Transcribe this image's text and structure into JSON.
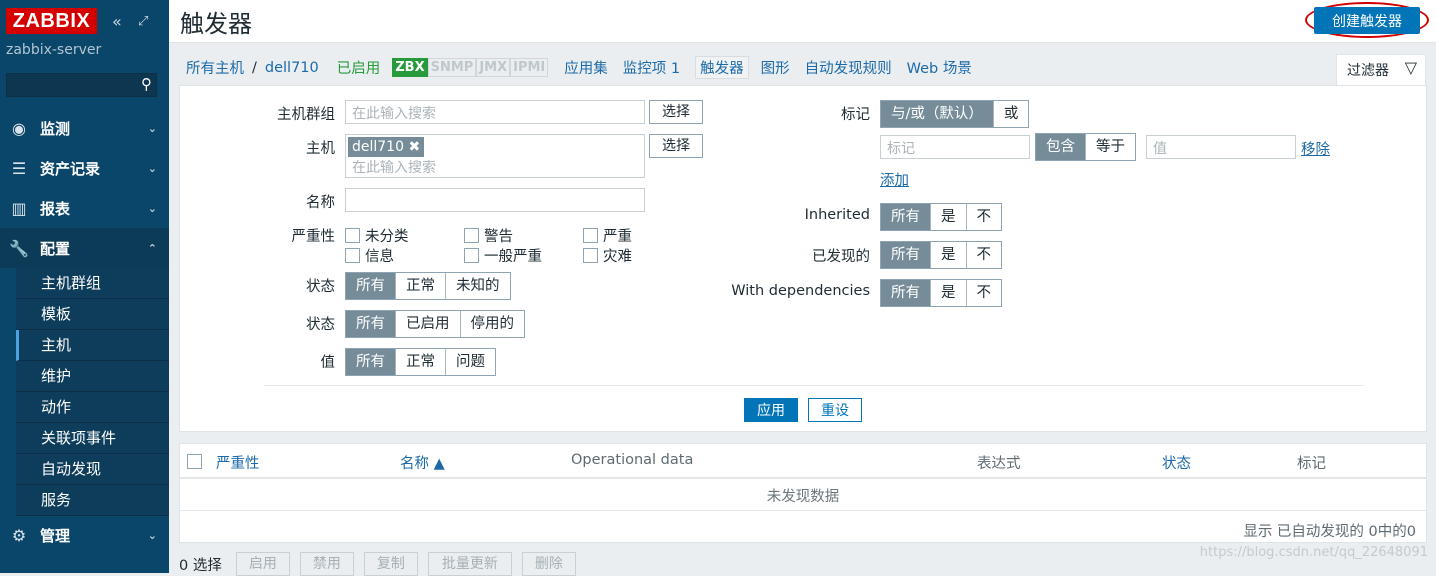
{
  "sidebar": {
    "logo": "ZABBIX",
    "server": "zabbix-server",
    "menu": [
      {
        "label": "监测",
        "icon": "eye-icon"
      },
      {
        "label": "资产记录",
        "icon": "list-icon"
      },
      {
        "label": "报表",
        "icon": "bar-chart-icon"
      },
      {
        "label": "配置",
        "icon": "wrench-icon"
      },
      {
        "label": "管理",
        "icon": "gear-icon"
      }
    ],
    "submenu": [
      "主机群组",
      "模板",
      "主机",
      "维护",
      "动作",
      "关联项事件",
      "自动发现",
      "服务"
    ]
  },
  "header": {
    "title": "触发器",
    "create_button": "创建触发器"
  },
  "nav": {
    "all_hosts": "所有主机",
    "sep": "/",
    "host": "dell710",
    "enabled": "已启用",
    "tags": [
      "ZBX",
      "SNMP",
      "JMX",
      "IPMI"
    ],
    "links": [
      "应用集",
      "监控项 1",
      "触发器",
      "图形",
      "自动发现规则",
      "Web 场景"
    ],
    "filter_tab": "过滤器"
  },
  "filter": {
    "host_group_label": "主机群组",
    "search_placeholder": "在此输入搜索",
    "select_button": "选择",
    "host_label": "主机",
    "host_chip": "dell710",
    "name_label": "名称",
    "severity_label": "严重性",
    "severities": [
      "未分类",
      "警告",
      "严重",
      "信息",
      "一般严重",
      "灾难"
    ],
    "state_label": "状态",
    "state_options": [
      "所有",
      "正常",
      "未知的"
    ],
    "status_label": "状态",
    "status_options": [
      "所有",
      "已启用",
      "停用的"
    ],
    "value_label": "值",
    "value_options": [
      "所有",
      "正常",
      "问题"
    ],
    "tags_label": "标记",
    "tags_ops": [
      "与/或（默认）",
      "或"
    ],
    "tag_placeholder": "标记",
    "tag_match": [
      "包含",
      "等于"
    ],
    "value_placeholder": "值",
    "remove": "移除",
    "add": "添加",
    "inherited_label": "Inherited",
    "discovered_label": "已发现的",
    "deps_label": "With dependencies",
    "tri_options": [
      "所有",
      "是",
      "不"
    ],
    "apply": "应用",
    "reset": "重设"
  },
  "table": {
    "columns": [
      "严重性",
      "名称 ▲",
      "Operational data",
      "表达式",
      "状态",
      "标记"
    ],
    "empty": "未发现数据",
    "footer": "显示 已自动发现的 0中的0"
  },
  "bottom": {
    "selected": "0 选择",
    "actions": [
      "启用",
      "禁用",
      "复制",
      "批量更新",
      "删除"
    ]
  },
  "watermark": "https://blog.csdn.net/qq_22648091"
}
